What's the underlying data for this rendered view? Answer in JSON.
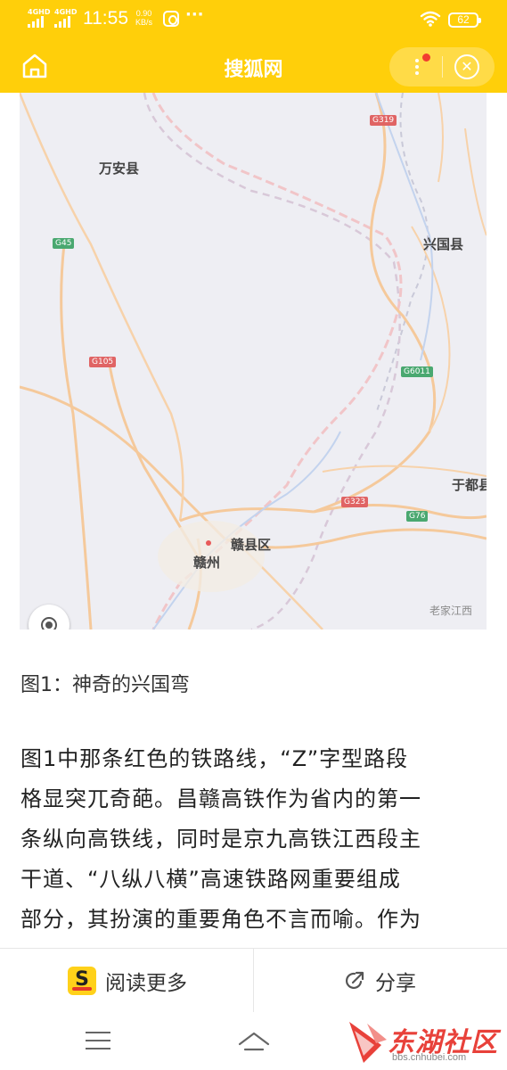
{
  "status_bar": {
    "sim1": "4GHD",
    "sim2": "4GHD",
    "time": "11:55",
    "net_speed_value": "0.90",
    "net_speed_unit": "KB/s",
    "more_indicator": "···",
    "battery": "62"
  },
  "header": {
    "title": "搜狐网",
    "home_icon": "home-icon",
    "menu_icon": "more-vertical-icon",
    "close_icon": "close-circle-icon",
    "accent_color": "#ffcf0a",
    "notification_dot_color": "#f23d30"
  },
  "map": {
    "labels": {
      "wanan": "万安县",
      "xingguo": "兴国县",
      "yudu": "于都县",
      "ganxian": "赣县区",
      "ganzhou": "赣州"
    },
    "road_shields": {
      "g319": "G319",
      "g45": "G45",
      "g105": "G105",
      "g6011": "G6011",
      "g323": "G323",
      "g76": "G76"
    },
    "watermark": "老家江西",
    "locate_icon": "locate-icon"
  },
  "article": {
    "caption": "图1：神奇的兴国弯",
    "lines": [
      "图1中那条红色的铁路线，“Z”字型路段",
      "格显突兀奇葩。昌赣高铁作为省内的第一",
      "条纵向高铁线，同时是京九高铁江西段主",
      "干道、“八纵八横”高速铁路网重要组成",
      "部分，其扮演的重要角色不言而喻。作为"
    ]
  },
  "actions": {
    "read_more": "阅读更多",
    "share": "分享"
  },
  "watermark_brand": {
    "text": "东湖社区",
    "url": "bbs.cnhubei.com"
  }
}
